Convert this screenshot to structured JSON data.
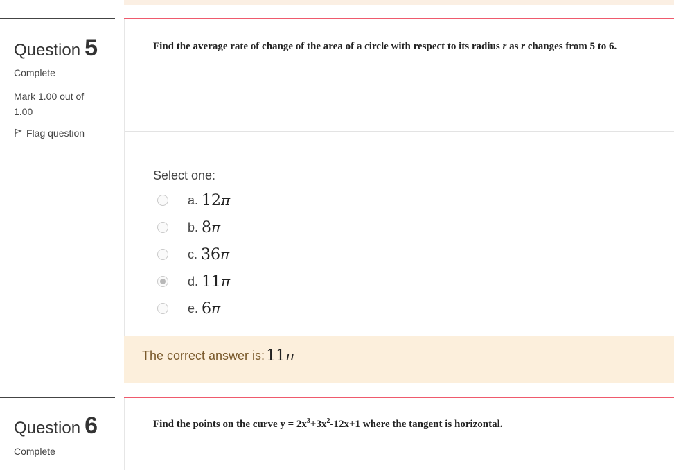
{
  "q5": {
    "title_word": "Question",
    "number": "5",
    "status": "Complete",
    "mark_label": "Mark 1.00 out of 1.00",
    "flag_label": "Flag question",
    "question_text_start": "Find the average rate of change of the area of a circle with respect to its radius ",
    "var1": "r",
    "question_text_mid": " as ",
    "var2": "r",
    "question_text_end": " changes from 5 to 6.",
    "select_prompt": "Select one:",
    "options": [
      {
        "letter": "a.",
        "coeff": "12",
        "pi": "π",
        "checked": false
      },
      {
        "letter": "b.",
        "coeff": "8",
        "pi": "π",
        "checked": false
      },
      {
        "letter": "c.",
        "coeff": "36",
        "pi": "π",
        "checked": false
      },
      {
        "letter": "d.",
        "coeff": "11",
        "pi": "π",
        "checked": true
      },
      {
        "letter": "e.",
        "coeff": "6",
        "pi": "π",
        "checked": false
      }
    ],
    "feedback_label": "The correct answer is:",
    "feedback_coeff": "11",
    "feedback_pi": "π"
  },
  "q6": {
    "title_word": "Question",
    "number": "6",
    "status": "Complete",
    "q_prefix": "Find the points on the curve y = 2x",
    "sup1": "3",
    "q_mid1": "+3x",
    "sup2": "2",
    "q_suffix": "-12x+1 where the tangent is horizontal."
  },
  "colors": {
    "accent_rule": "#ef5a6d",
    "feedback_bg": "#fcefdc",
    "feedback_text": "#7a5a2c"
  }
}
